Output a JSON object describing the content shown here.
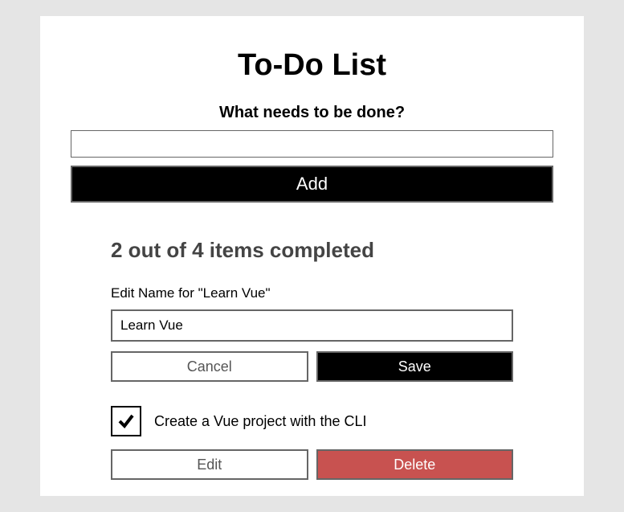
{
  "header": {
    "title": "To-Do List",
    "subtitle": "What needs to be done?"
  },
  "input": {
    "value": "",
    "add_label": "Add"
  },
  "status": {
    "text": "2 out of 4 items completed",
    "completed": 2,
    "total": 4
  },
  "edit": {
    "label": "Edit Name for \"Learn Vue\"",
    "value": "Learn Vue",
    "cancel_label": "Cancel",
    "save_label": "Save"
  },
  "item": {
    "checked": true,
    "label": "Create a Vue project with the CLI",
    "edit_label": "Edit",
    "delete_label": "Delete"
  },
  "colors": {
    "background": "#e5e5e5",
    "card": "#ffffff",
    "primary": "#000000",
    "danger": "#c85250",
    "border": "#666666",
    "text_muted": "#444444"
  }
}
